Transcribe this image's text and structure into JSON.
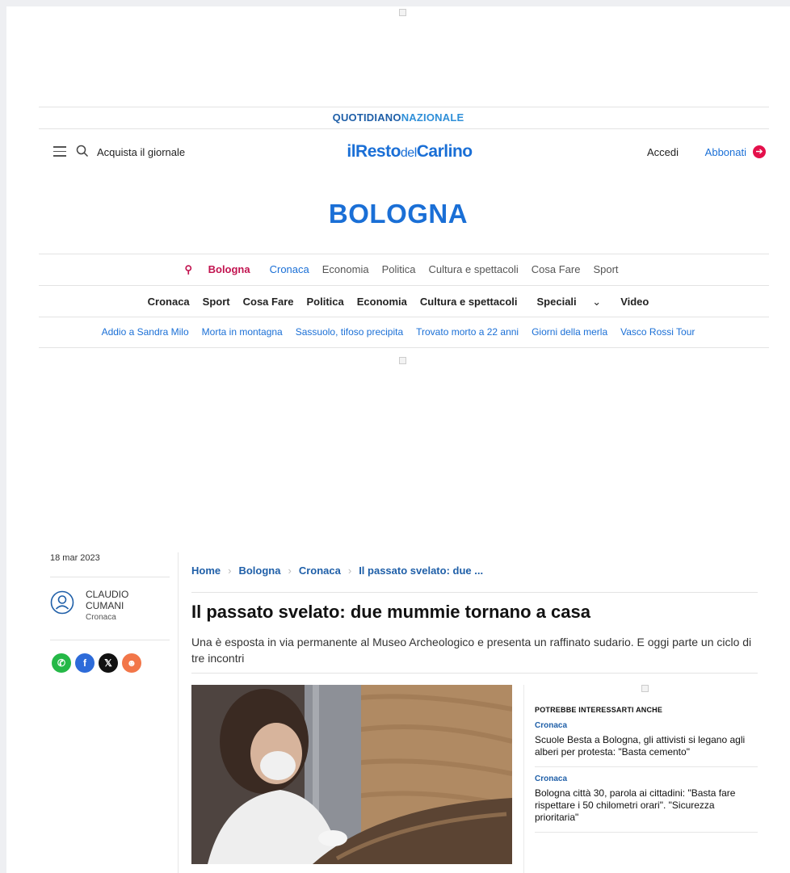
{
  "masthead": {
    "network_left": "QUOTIDIANO",
    "network_right": "NAZIONALE",
    "buy_label": "Acquista il giornale",
    "logo_il": "il",
    "logo_resto": "Resto",
    "logo_del": "del",
    "logo_carlino": "Carlino",
    "login_label": "Accedi",
    "subscribe_label": "Abbonati"
  },
  "city": "BOLOGNA",
  "nav_primary": {
    "location": "Bologna",
    "items": [
      "Cronaca",
      "Economia",
      "Politica",
      "Cultura e spettacoli",
      "Cosa Fare",
      "Sport"
    ]
  },
  "nav_sections": [
    "Cronaca",
    "Sport",
    "Cosa Fare",
    "Politica",
    "Economia",
    "Cultura e spettacoli",
    "Speciali",
    "Video"
  ],
  "nav_topics": [
    "Addio a Sandra Milo",
    "Morta in montagna",
    "Sassuolo, tifoso precipita",
    "Trovato morto a 22 anni",
    "Giorni della merla",
    "Vasco Rossi Tour"
  ],
  "article": {
    "date": "18 mar 2023",
    "author_first": "CLAUDIO",
    "author_last": "CUMANI",
    "author_section": "Cronaca",
    "breadcrumb": [
      "Home",
      "Bologna",
      "Cronaca",
      "Il passato svelato: due ..."
    ],
    "title": "Il passato svelato: due mummie tornano a casa",
    "summary": "Una è esposta in via permanente al Museo Archeologico e presenta un raffinato sudario. E oggi parte un ciclo di tre incontri"
  },
  "share": [
    {
      "icon": "whatsapp-icon",
      "color": "#25b847"
    },
    {
      "icon": "facebook-icon",
      "color": "#2d6bd9"
    },
    {
      "icon": "x-icon",
      "color": "#111111"
    },
    {
      "icon": "reddit-icon",
      "color": "#f27649"
    }
  ],
  "related": {
    "heading": "POTREBBE INTERESSARTI ANCHE",
    "items": [
      {
        "category": "Cronaca",
        "title": "Scuole Besta a Bologna, gli attivisti si legano agli alberi per protesta: \"Basta cemento\""
      },
      {
        "category": "Cronaca",
        "title": "Bologna città 30, parola ai cittadini: \"Basta fare rispettare i 50 chilometri orari\". \"Sicurezza prioritaria\""
      }
    ]
  },
  "colors": {
    "brand": "#1a6fd6",
    "accent": "#e4104b",
    "location": "#c21450"
  }
}
